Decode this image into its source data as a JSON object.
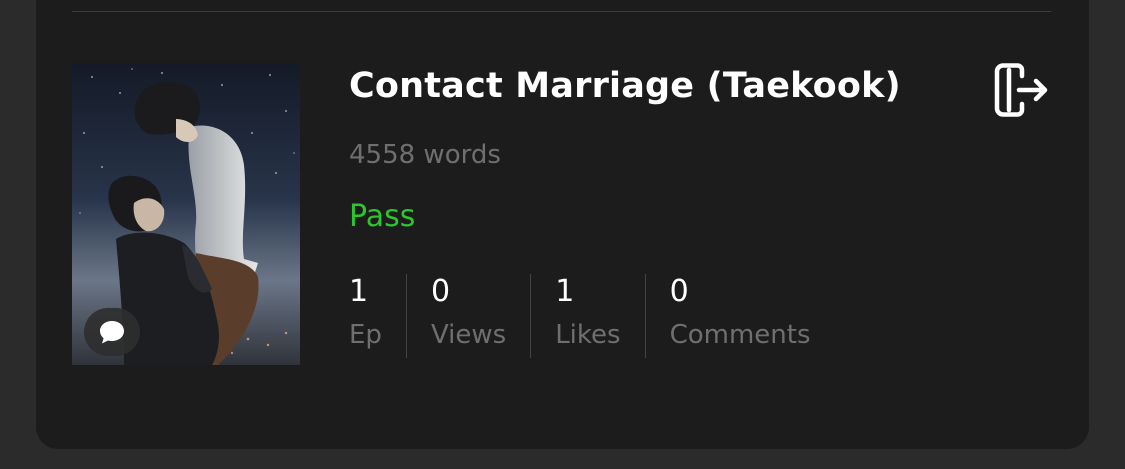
{
  "card": {
    "title": "Contact Marriage (Taekook)",
    "word_count": "4558 words",
    "status": "Pass",
    "status_color": "#2dc52d",
    "stats": [
      {
        "value": "1",
        "label": "Ep"
      },
      {
        "value": "0",
        "label": "Views"
      },
      {
        "value": "1",
        "label": "Likes"
      },
      {
        "value": "0",
        "label": "Comments"
      }
    ],
    "icons": {
      "cover_badge": "comment-icon",
      "action": "exit-icon"
    }
  }
}
